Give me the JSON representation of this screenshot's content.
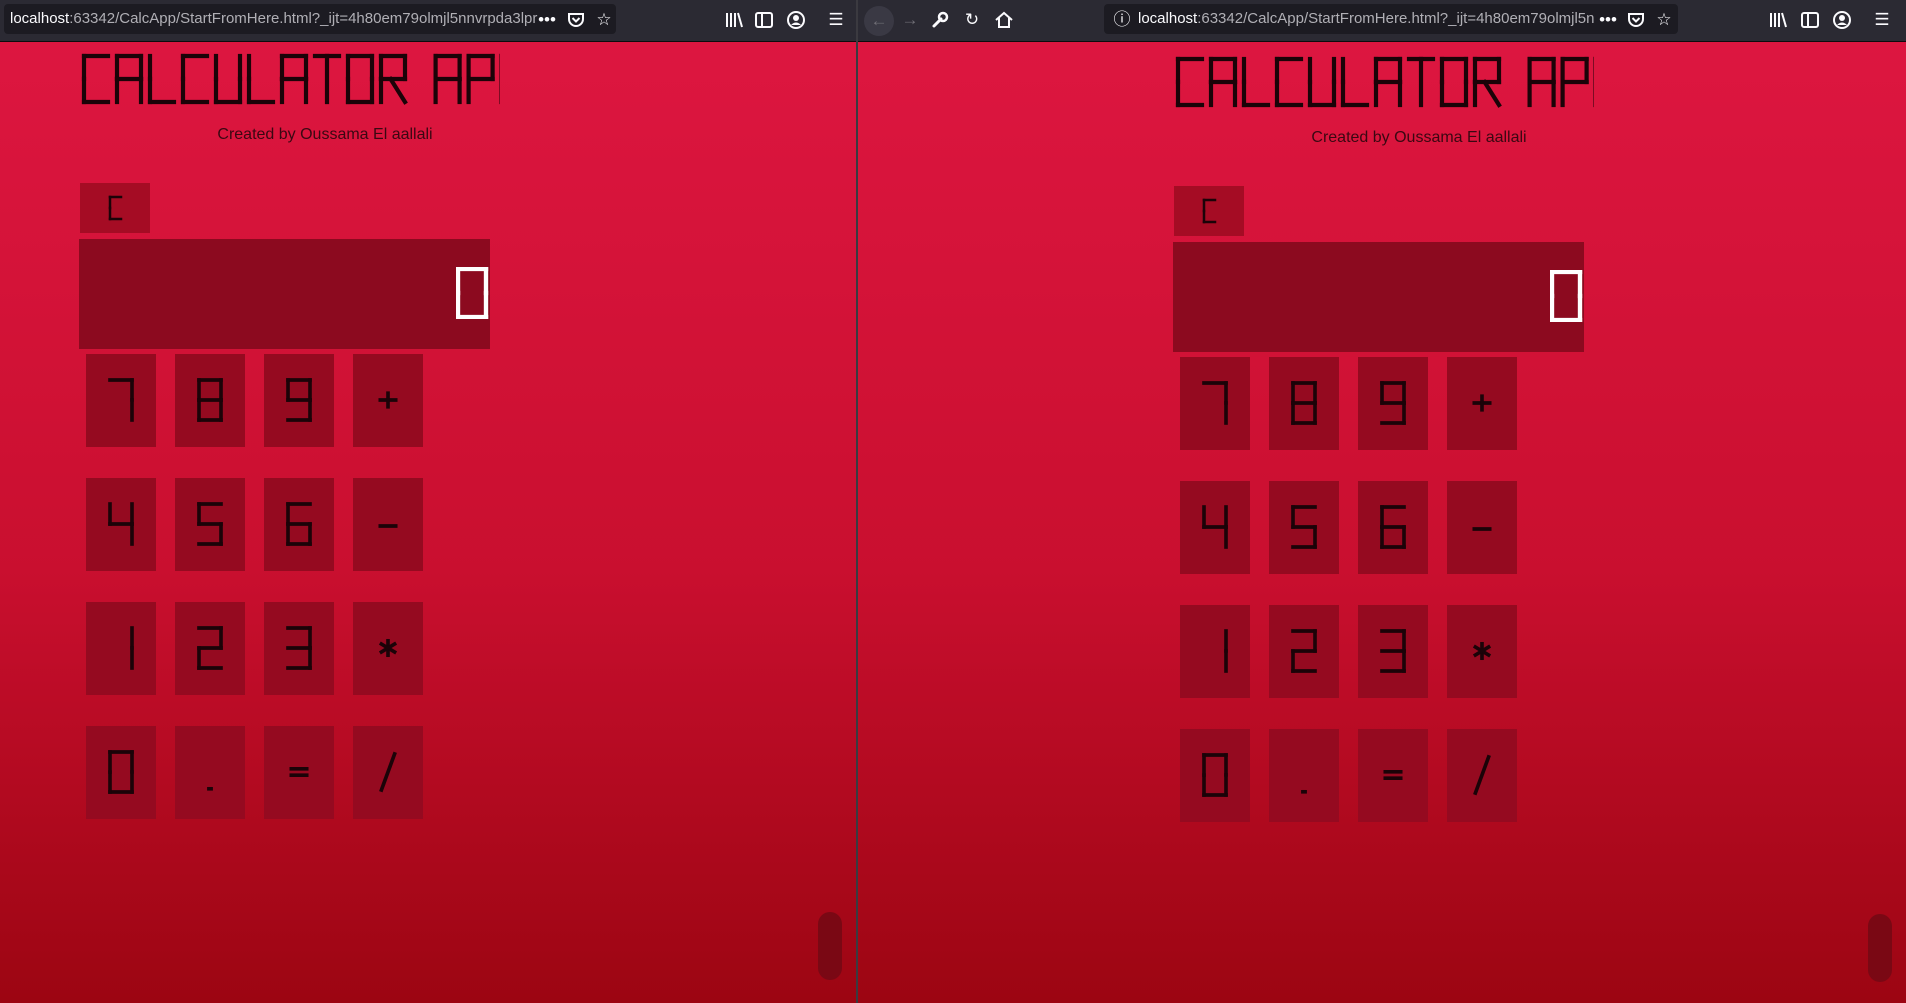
{
  "windows": [
    {
      "id": "left",
      "url_host": "localhost",
      "url_rest": ":63342/CalcApp/StartFromHere.html?_ijt=4h80em79olmjl5nnvrpda3lpr",
      "show_nav": false
    },
    {
      "id": "right",
      "url_host": "localhost",
      "url_rest": ":63342/CalcApp/StartFromHere.html?_ijt=4h80em79olmjl5n",
      "show_nav": true
    }
  ],
  "icons": {
    "back": "arrow-left-icon",
    "forward": "arrow-right-icon",
    "tools": "wrench-icon",
    "reload": "reload-icon",
    "home": "home-icon",
    "info": "info-icon",
    "more": "more-icon",
    "pocket": "pocket-icon",
    "bookmark": "star-icon",
    "library": "library-icon",
    "sidebar": "sidebar-icon",
    "account": "account-icon",
    "menu": "hamburger-menu-icon"
  },
  "calculator": {
    "title": "CALCULATOR APP",
    "credit": "Created by Oussama El aallali",
    "clear_label": "C",
    "display_value": "0",
    "keys": [
      [
        "7",
        "8",
        "9",
        "+"
      ],
      [
        "4",
        "5",
        "6",
        "-"
      ],
      [
        "1",
        "2",
        "3",
        "*"
      ],
      [
        "0",
        ".",
        "=",
        "/"
      ]
    ]
  },
  "colors": {
    "page_top": "#dd1640",
    "page_bottom": "#9c0512",
    "key_bg": "#950a20",
    "display_bg": "#8c0a1f",
    "digit_dark": "#1b0308",
    "digit_light": "#ffffff"
  }
}
